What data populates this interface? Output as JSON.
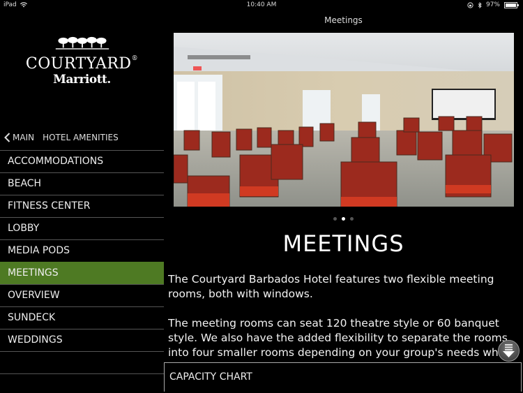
{
  "status_bar": {
    "device": "iPad",
    "time": "10:40 AM",
    "battery": "97%",
    "battery_level": 0.97,
    "icons": [
      "wifi-icon",
      "orientation-lock-icon",
      "bluetooth-icon",
      "battery-icon"
    ]
  },
  "nav": {
    "title": "Meetings"
  },
  "logo": {
    "brand": "COURTYARD",
    "registered": "®",
    "sub": "Marriott."
  },
  "breadcrumb": {
    "back_label": "MAIN",
    "current": "HOTEL AMENITIES"
  },
  "menu": {
    "items": [
      {
        "label": "ACCOMMODATIONS",
        "active": false
      },
      {
        "label": "BEACH",
        "active": false
      },
      {
        "label": "FITNESS CENTER",
        "active": false
      },
      {
        "label": "LOBBY",
        "active": false
      },
      {
        "label": "MEDIA PODS",
        "active": false
      },
      {
        "label": "MEETINGS",
        "active": true
      },
      {
        "label": "OVERVIEW",
        "active": false
      },
      {
        "label": "SUNDECK",
        "active": false
      },
      {
        "label": "WEDDINGS",
        "active": false
      }
    ],
    "active_color": "#4e7a23"
  },
  "gallery": {
    "image_alt": "Meeting room with red chairs arranged theatre style facing a projection screen",
    "page_count": 3,
    "current_page": 2
  },
  "content": {
    "heading": "MEETINGS",
    "paragraphs": [
      "The Courtyard Barbados Hotel features two flexible meeting rooms, both with windows.",
      "The meeting rooms can seat 120 theatre style or 60 banquet style. We also have the added flexibility to separate the rooms into four smaller rooms depending on your group's needs while"
    ]
  },
  "capacity_chart": {
    "label": "CAPACITY CHART"
  }
}
